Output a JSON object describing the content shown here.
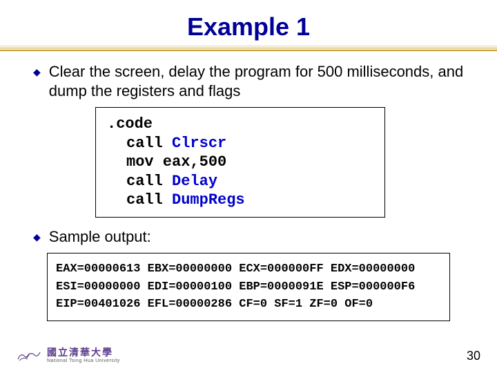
{
  "title": "Example 1",
  "bullets": [
    "Clear the screen, delay the program for 500 milliseconds, and dump the registers and flags",
    "Sample output:"
  ],
  "code": {
    "l0": ".code",
    "l1a": "call ",
    "l1b": "Clrscr",
    "l2a": "mov  eax,500",
    "l3a": "call ",
    "l3b": "Delay",
    "l4a": "call ",
    "l4b": "DumpRegs"
  },
  "output": {
    "line1": "EAX=00000613 EBX=00000000 ECX=000000FF EDX=00000000",
    "line2": "ESI=00000000 EDI=00000100 EBP=0000091E ESP=000000F6",
    "line3": "EIP=00401026 EFL=00000286 CF=0 SF=1 ZF=0 OF=0"
  },
  "footer": {
    "uni_cn": "國立清華大學",
    "uni_en": "National Tsing Hua University",
    "page": "30"
  }
}
